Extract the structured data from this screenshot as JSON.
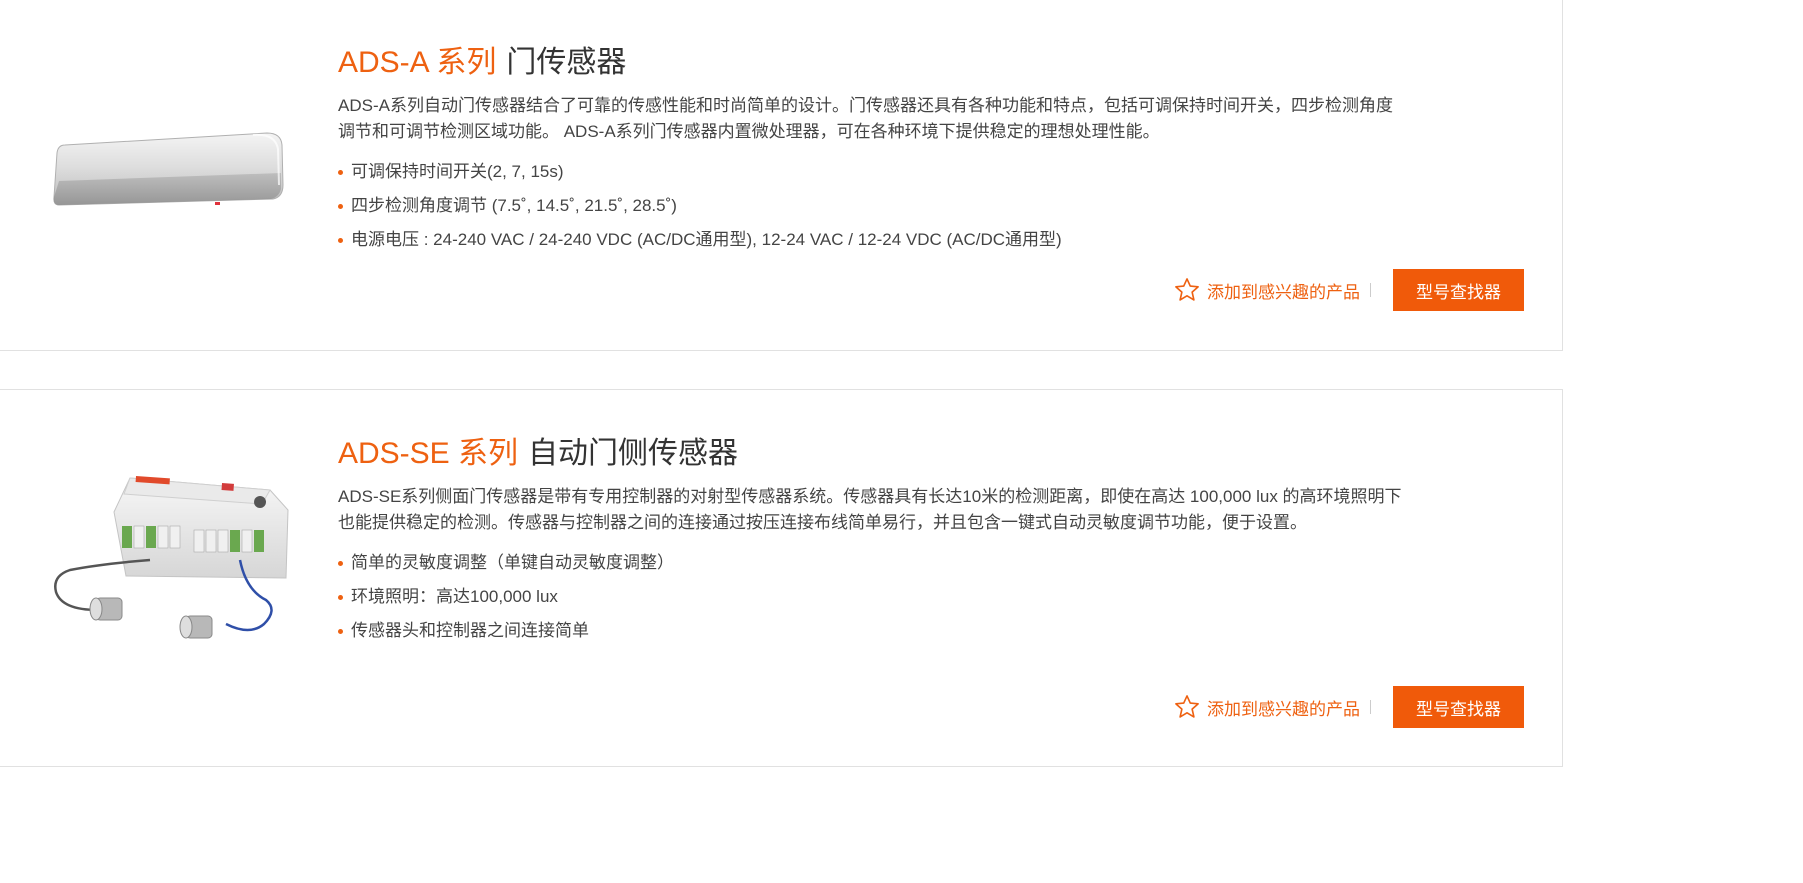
{
  "products": [
    {
      "series": "ADS-A 系列",
      "name": "门传感器",
      "description": "ADS-A系列自动门传感器结合了可靠的传感性能和时尚简单的设计。门传感器还具有各种功能和特点，包括可调保持时间开关，四步检测角度调节和可调节检测区域功能。 ADS-A系列门传感器内置微处理器，可在各种环境下提供稳定的理想处理性能。",
      "features": [
        "可调保持时间开关(2, 7, 15s)",
        "四步检测角度调节 (7.5˚, 14.5˚, 21.5˚, 28.5˚)",
        "电源电压 : 24-240 VAC / 24-240 VDC (AC/DC通用型), 12-24 VAC / 12-24 VDC (AC/DC通用型)"
      ],
      "favorite_label": "添加到感兴趣的产品",
      "finder_label": "型号查找器"
    },
    {
      "series": "ADS-SE 系列",
      "name": "自动门侧传感器",
      "description": "ADS-SE系列侧面门传感器是带有专用控制器的对射型传感器系统。传感器具有长达10米的检测距离，即使在高达 100,000 lux 的高环境照明下也能提供稳定的检测。传感器与控制器之间的连接通过按压连接布线简单易行，并且包含一键式自动灵敏度调节功能，便于设置。",
      "features": [
        "简单的灵敏度调整（单键自动灵敏度调整）",
        "环境照明：高达100,000 lux",
        "传感器头和控制器之间连接简单"
      ],
      "favorite_label": "添加到感兴趣的产品",
      "finder_label": "型号查找器"
    }
  ],
  "colors": {
    "accent": "#ee6111",
    "button": "#f05a0a",
    "text": "#333333"
  },
  "icons": {
    "favorite": "star-outline-icon"
  }
}
